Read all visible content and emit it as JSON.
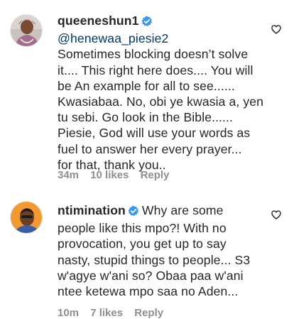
{
  "comments": [
    {
      "username": "queeneshun1",
      "mention": "@henewaa_piesie2",
      "lines": [
        "Sometimes blocking doesn’t solve",
        "it.... This right here does.... You will",
        "be An example for all to see......",
        "Kwasiabaa. No, obi ye kwasia a, yen",
        "tu sebi. Go look in the Bible......",
        "Piesie, God will use your words as",
        "fuel to answer her every prayer...",
        "for that, thank you.."
      ],
      "time": "34m",
      "likes": "10 likes",
      "reply": "Reply",
      "avatar_icon": "profile-photo-woman",
      "like_icon": "heart-outline-icon"
    },
    {
      "username": "ntimination",
      "first_line_rest": "Why are some",
      "lines": [
        "people like this mpo?! With no",
        "provocation, you get up to say",
        "nasty, stupid things to people... S3",
        "w'agye w'ani so? Obaa paa w'ani",
        "ntee ketewa mpo saa no Aden..."
      ],
      "time": "10m",
      "likes": "7 likes",
      "reply": "Reply",
      "avatar_icon": "profile-photo-man",
      "like_icon": "heart-outline-icon"
    }
  ],
  "colors": {
    "text": "#262626",
    "meta": "#8e8e8e",
    "verified": "#3897f0",
    "mention": "#00376b"
  }
}
